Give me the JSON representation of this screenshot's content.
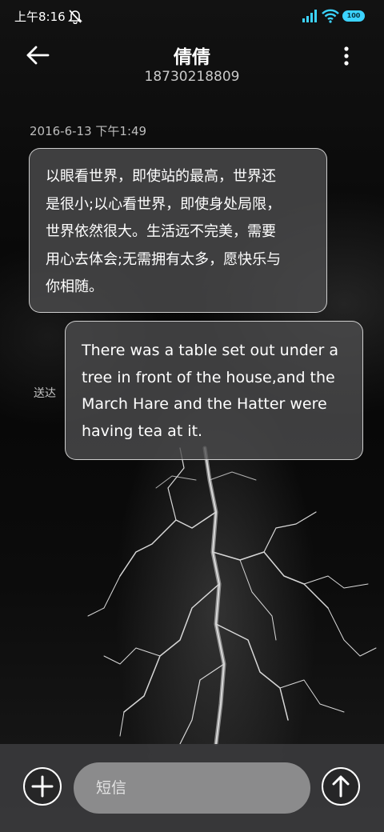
{
  "status_bar": {
    "time": "上午8:16",
    "icons": [
      "mute-icon",
      "signal-icon",
      "wifi-icon",
      "battery-icon"
    ],
    "battery": "100",
    "accent_color": "#3cd3ff"
  },
  "header": {
    "contact_name": "倩倩",
    "phone_number": "18730218809",
    "back_icon": "arrow-left-icon",
    "menu_icon": "more-vertical-icon"
  },
  "conversation": {
    "timestamp": "2016-6-13 下午1:49",
    "messages": [
      {
        "direction": "incoming",
        "lines": [
          "以眼看世界，即使站的最高，世界还",
          "是很小;以心看世界，即使身处局限，",
          "世界依然很大。生活远不完美，需要",
          "用心去体会;无需拥有太多，愿快乐与",
          "你相随。"
        ]
      },
      {
        "direction": "outgoing",
        "status": "送达",
        "lines": [
          "There was a table set out under a",
          "tree in front of the house,and the",
          "March Hare and the Hatter were",
          "having tea at it."
        ]
      }
    ]
  },
  "composer": {
    "placeholder": "短信",
    "value": "",
    "attach_icon": "plus-icon",
    "send_icon": "arrow-up-icon"
  }
}
